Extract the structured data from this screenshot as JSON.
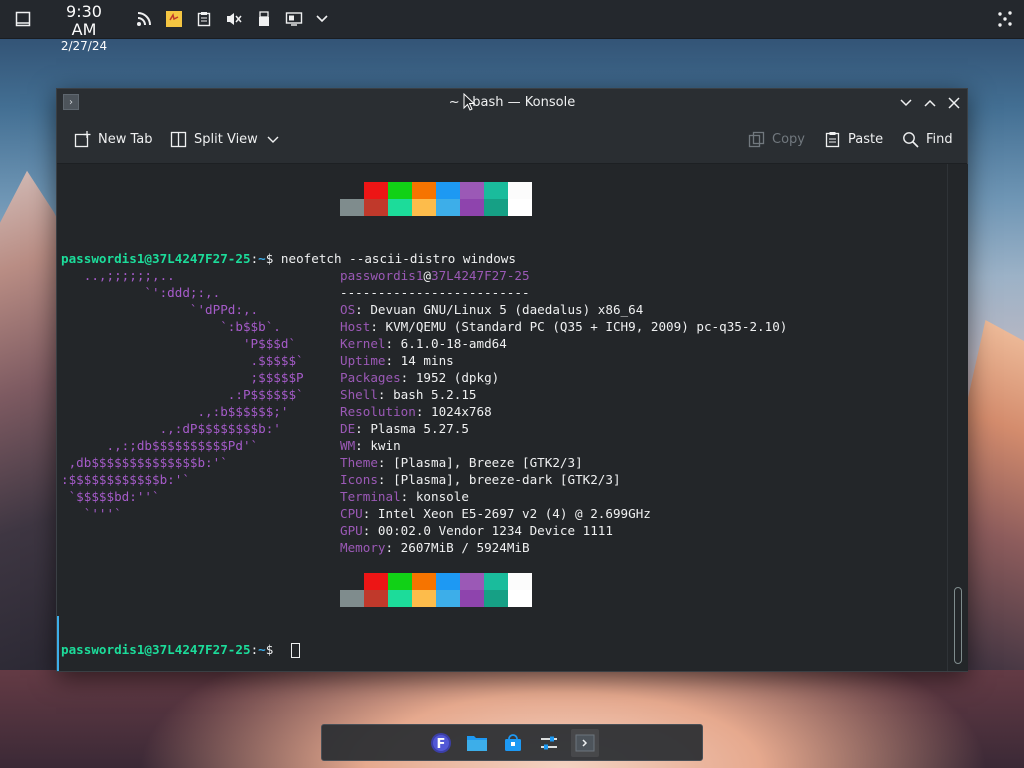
{
  "panel": {
    "time": "9:30 AM",
    "date": "2/27/24",
    "icons": [
      "show-desktop-icon",
      "rss-icon",
      "sticky-note-icon",
      "clipboard-icon",
      "volume-muted-icon",
      "usb-drive-icon",
      "display-config-icon",
      "chevron-down-icon",
      "network-icon"
    ]
  },
  "window": {
    "title": "~ : bash — Konsole",
    "toolbar": {
      "new_tab": "New Tab",
      "split_view": "Split View",
      "copy": "Copy",
      "paste": "Paste",
      "find": "Find"
    }
  },
  "terminal": {
    "prompt_user": "passwordis1@37L4247F27-25",
    "prompt_sep": ":",
    "prompt_path": "~",
    "prompt_sym": "$ ",
    "command": "neofetch --ascii-distro windows",
    "info_user": "passwordis1",
    "info_at": "@",
    "info_host": "37L4247F27-25",
    "separator": "-------------------------",
    "ascii": [
      "   ..,;;;;;;,..",
      "           `':ddd;:,.",
      "                 `'dPPd:,.",
      "                     `:b$$b`.",
      "                        'P$$$d`",
      "                         .$$$$$`",
      "                         ;$$$$$P",
      "                      .:P$$$$$$`",
      "                  .,:b$$$$$$;'",
      "             .,:dP$$$$$$$$b:'",
      "      .,:;db$$$$$$$$$$Pd'`",
      " ,db$$$$$$$$$$$$$$b:'`",
      ":$$$$$$$$$$$$b:'`",
      " `$$$$$bd:''`",
      "   `'''`"
    ],
    "info": [
      {
        "key": "OS",
        "value": "Devuan GNU/Linux 5 (daedalus) x86_64"
      },
      {
        "key": "Host",
        "value": "KVM/QEMU (Standard PC (Q35 + ICH9, 2009) pc-q35-2.10)"
      },
      {
        "key": "Kernel",
        "value": "6.1.0-18-amd64"
      },
      {
        "key": "Uptime",
        "value": "14 mins"
      },
      {
        "key": "Packages",
        "value": "1952 (dpkg)"
      },
      {
        "key": "Shell",
        "value": "bash 5.2.15"
      },
      {
        "key": "Resolution",
        "value": "1024x768"
      },
      {
        "key": "DE",
        "value": "Plasma 5.27.5"
      },
      {
        "key": "WM",
        "value": "kwin"
      },
      {
        "key": "Theme",
        "value": "[Plasma], Breeze [GTK2/3]"
      },
      {
        "key": "Icons",
        "value": "[Plasma], breeze-dark [GTK2/3]"
      },
      {
        "key": "Terminal",
        "value": "konsole"
      },
      {
        "key": "CPU",
        "value": "Intel Xeon E5-2697 v2 (4) @ 2.699GHz"
      },
      {
        "key": "GPU",
        "value": "00:02.0 Vendor 1234 Device 1111"
      },
      {
        "key": "Memory",
        "value": "2607MiB / 5924MiB"
      }
    ],
    "palette_top": [
      "#232629",
      "#ed1515",
      "#11d116",
      "#f67400",
      "#1d99f3",
      "#9b59b6",
      "#1abc9c",
      "#fcfcfc"
    ],
    "palette_bottom": [
      "#7f8c8d",
      "#c0392b",
      "#1cdc9a",
      "#fdbc4b",
      "#3daee9",
      "#8e44ad",
      "#16a085",
      "#ffffff"
    ]
  },
  "dock": {
    "apps": [
      "fedora-launcher-icon",
      "file-manager-icon",
      "store-icon",
      "settings-icon",
      "konsole-icon"
    ]
  }
}
